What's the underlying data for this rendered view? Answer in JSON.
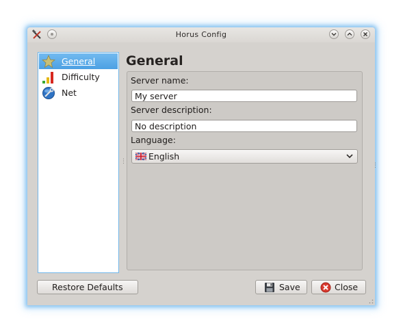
{
  "window": {
    "title": "Horus Config"
  },
  "sidebar": {
    "items": [
      {
        "label": "General",
        "icon": "star-icon",
        "selected": true
      },
      {
        "label": "Difficulty",
        "icon": "bars-icon",
        "selected": false
      },
      {
        "label": "Net",
        "icon": "wrench-globe-icon",
        "selected": false
      }
    ]
  },
  "page": {
    "title": "General"
  },
  "form": {
    "server_name_label": "Server name:",
    "server_name_value": "My server",
    "server_description_label": "Server description:",
    "server_description_value": "No description",
    "language_label": "Language:",
    "language_value": "English",
    "language_flag": "uk-flag-icon"
  },
  "buttons": {
    "restore_defaults": "Restore Defaults",
    "save": "Save",
    "close": "Close"
  },
  "colors": {
    "accent": "#4ca0e3",
    "window_bg": "#d5d2ce",
    "close_red": "#d93a2f"
  }
}
